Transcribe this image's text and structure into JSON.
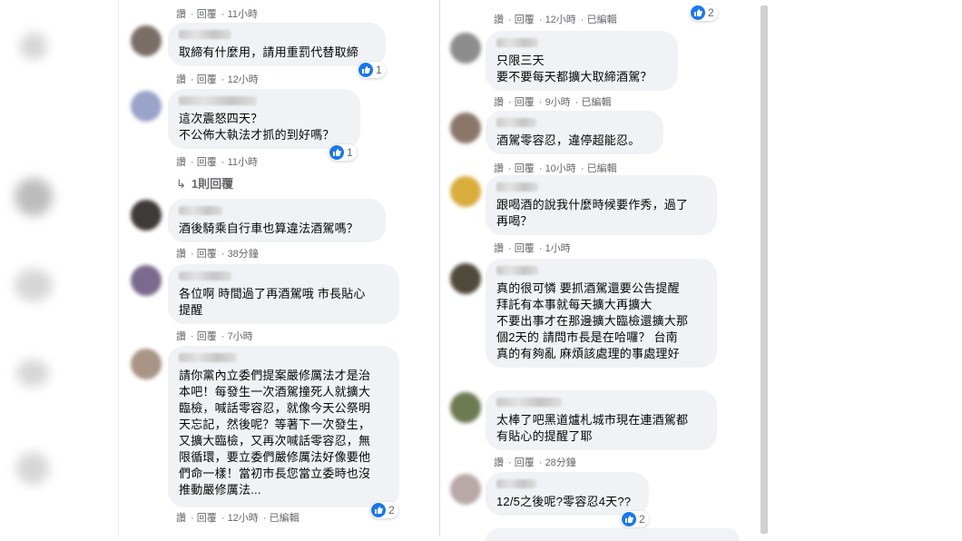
{
  "meta_labels": {
    "like": "讚",
    "reply": "回覆",
    "edited": "已編輯"
  },
  "left": {
    "top_meta": {
      "time": "11小時"
    },
    "comments": [
      {
        "id": "c1",
        "text": "取締有什麼用，請用重罰代替取締",
        "time": "12小時",
        "reactions": "1",
        "edited": false
      },
      {
        "id": "c2",
        "text": "這次震怒四天？\n不公佈大執法才抓的到好嗎？",
        "time": "11小時",
        "reactions": "1",
        "edited": false,
        "replies": "1則回覆"
      },
      {
        "id": "c3",
        "text": "酒後騎乘自行車也算違法酒駕嗎？",
        "time": "38分鐘",
        "reactions": "",
        "edited": false
      },
      {
        "id": "c4",
        "text": "各位啊 時間過了再酒駕哦 市長貼心\n提醒",
        "time": "7小時",
        "reactions": "",
        "edited": false
      },
      {
        "id": "c5",
        "text": "請你黨內立委們提案嚴修厲法才是治\n本吧！每發生一次酒駕撞死人就擴大\n臨檢，喊話零容忍，就像今天公祭明\n天忘記，然後呢？等著下一次發生，\n又擴大臨檢，又再次喊話零容忍，無\n限循環，要立委們嚴修厲法好像要他\n們命一樣！當初市長您當立委時也沒\n推動嚴修厲法...",
        "time": "12小時",
        "reactions": "2",
        "edited": true
      }
    ]
  },
  "right": {
    "top_meta": {
      "time": "12小時",
      "reactions": "2",
      "edited": true
    },
    "comments": [
      {
        "id": "r1",
        "text": "只限三天\n要不要每天都擴大取締酒駕？",
        "time": "9小時",
        "edited": true
      },
      {
        "id": "r2",
        "text": "酒駕零容忍，違停超能忍。",
        "time": "10小時",
        "edited": true
      },
      {
        "id": "r3",
        "text": "跟喝酒的說我什麼時候要作秀，過了\n再喝？",
        "time": "1小時",
        "edited": false
      },
      {
        "id": "r4",
        "text": "真的很可憐 要抓酒駕還要公告提醒\n拜託有本事就每天擴大再擴大\n不要出事才在那邊擴大臨檢還擴大那\n個2天的 請問市長是在哈囉？ 台南\n真的有夠亂 麻煩該處理的事處理好",
        "time": "",
        "edited": false
      },
      {
        "id": "r5",
        "text": "太棒了吧黑道爐札城市現在連酒駕都\n有貼心的提醒了耶",
        "time": "28分鐘",
        "edited": false
      },
      {
        "id": "r6",
        "text": "12/5之後呢?零容忍4天??",
        "time": "",
        "reactions": "2",
        "edited": false
      }
    ]
  },
  "colors": {
    "bubble": "#f0f2f5",
    "meta": "#65676b",
    "like": "#1877f2"
  }
}
